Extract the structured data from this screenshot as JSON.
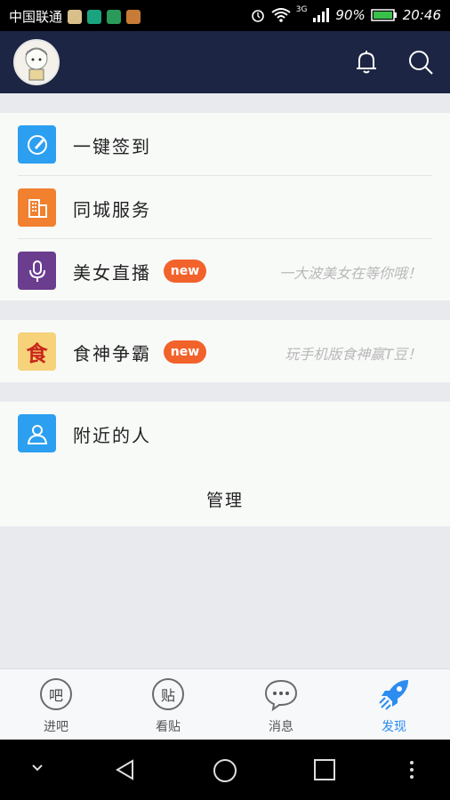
{
  "status_bar": {
    "carrier": "中国联通",
    "battery": "90%",
    "time": "20:46",
    "network": "3G"
  },
  "header": {
    "bell_icon": "bell-icon",
    "search_icon": "search-icon"
  },
  "rows": [
    {
      "label": "一键签到",
      "icon": "sign-in-icon",
      "color": "#2c9ff0"
    },
    {
      "label": "同城服务",
      "icon": "building-icon",
      "color": "#f1802f"
    },
    {
      "label": "美女直播",
      "icon": "microphone-icon",
      "color": "#6a3d8f",
      "badge": "new",
      "hint": "一大波美女在等你哦！"
    },
    {
      "label": "食神争霸",
      "icon": "food-game-icon",
      "color": "#f6d27a",
      "badge": "new",
      "hint": "玩手机版食神赢T豆！"
    },
    {
      "label": "附近的人",
      "icon": "person-icon",
      "color": "#2c9ff0"
    }
  ],
  "manage_label": "管理",
  "tabs": [
    {
      "label": "进吧",
      "glyph": "吧"
    },
    {
      "label": "看贴",
      "glyph": "贴"
    },
    {
      "label": "消息",
      "glyph": "···"
    },
    {
      "label": "发现",
      "active": true
    }
  ],
  "colors": {
    "header_bg": "#1c2543",
    "accent_blue": "#2c9ff0",
    "badge_orange": "#f2622b"
  }
}
